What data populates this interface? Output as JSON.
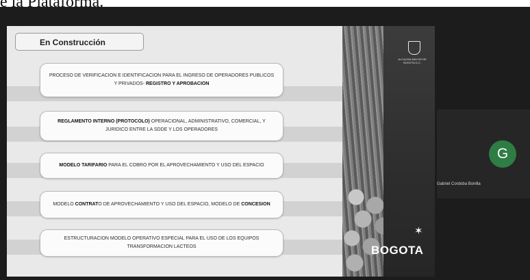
{
  "caption": {
    "text": "e la Plataforma."
  },
  "slide": {
    "title": "En Construcción",
    "items": [
      {
        "parts": [
          {
            "text": "PROCESO DE VERIFICACION E IDENTIFICACION PARA EL  INGRESO DE OPERADORES PUBLICOS Y PRIVADOS- ",
            "bold": false
          },
          {
            "text": "REGISTRO Y APROBACION",
            "bold": true
          }
        ]
      },
      {
        "parts": [
          {
            "text": "REGLAMENTO INTERNO (PROTOCOLO)",
            "bold": true
          },
          {
            "text": " OPERACIONAL, ADMINISTRATIVO, COMERCIAL, Y JURIDICO ENTRE LA SDDE Y LOS OPERADORES",
            "bold": false
          }
        ]
      },
      {
        "parts": [
          {
            "text": "MODELO TARIFARIO",
            "bold": true
          },
          {
            "text": " PARA EL COBRO POR EL APROVECHAMIENTO Y USO DEL ESPACIO",
            "bold": false
          }
        ]
      },
      {
        "parts": [
          {
            "text": "MODELO ",
            "bold": false
          },
          {
            "text": "CONTRAT",
            "bold": true
          },
          {
            "text": "O DE APROVECHAMIENTO Y USO DEL ESPACIO, MODELO DE ",
            "bold": false
          },
          {
            "text": "CONCESION",
            "bold": true
          }
        ]
      },
      {
        "parts": [
          {
            "text": "ESTRUCTURACION MODELO OPERATIVO ESPECIAL PARA EL USO DE LOS EQUIPOS TRANSFORMACION LACTEOS",
            "bold": false
          }
        ]
      }
    ],
    "brand": {
      "logo_text": "BOGOTA",
      "crest_text": "ALCALDIA MAYOR DE BOGOTA D.C."
    }
  },
  "participant": {
    "initial": "G",
    "name": "Gabriel Cordoba Bonilla",
    "avatar_color": "#2e7d44"
  },
  "icons": {
    "crest": "coat-of-arms-icon",
    "star": "star-icon"
  }
}
